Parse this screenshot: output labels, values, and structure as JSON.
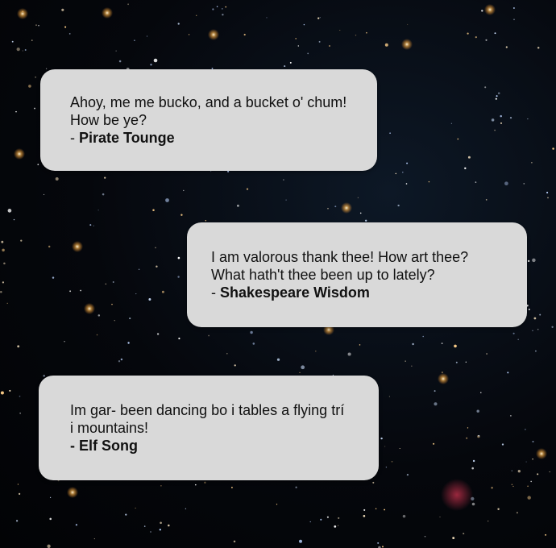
{
  "background": {
    "colors": {
      "sky": "#05070c",
      "bubble": "#d9d9d9",
      "text": "#111111"
    }
  },
  "messages": [
    {
      "text": "Ahoy, me me bucko, and a bucket o' chum! How be ye?",
      "prefix": "- ",
      "author": "Pirate Tounge"
    },
    {
      "text": "I am valorous thank thee! How art thee? What hath't thee been up to lately?",
      "prefix": "- ",
      "author": "Shakespeare Wisdom"
    },
    {
      "text": "Im gar- been dancing bo i tables a flying trí i mountains!",
      "prefix": "",
      "author": "- Elf Song"
    }
  ]
}
